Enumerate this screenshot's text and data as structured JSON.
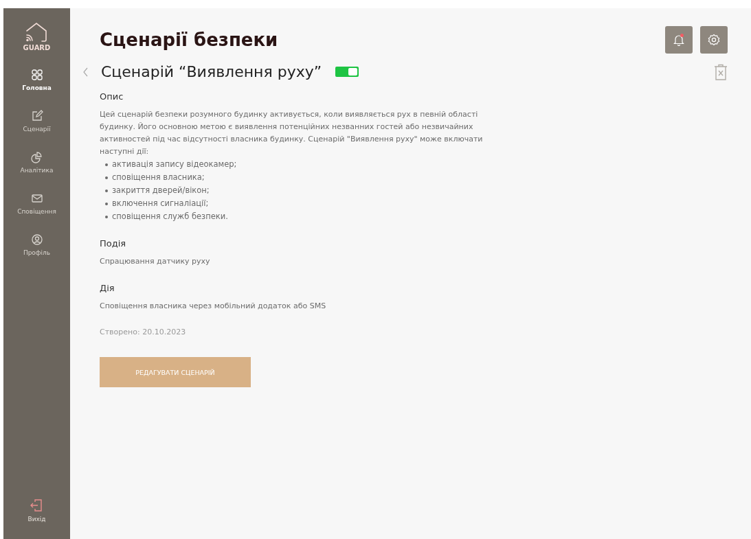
{
  "sidebar": {
    "logo": "GUARD",
    "items": [
      {
        "label": "Головна",
        "kind": "grid",
        "selected": true
      },
      {
        "label": "Сценарії",
        "kind": "edit",
        "selected": false
      },
      {
        "label": "Аналітика",
        "kind": "chart",
        "selected": false
      },
      {
        "label": "Сповіщення",
        "kind": "mail",
        "selected": false
      },
      {
        "label": "Профіль",
        "kind": "user",
        "selected": false
      }
    ],
    "logout": "Вихід"
  },
  "header": {
    "title": "Сценарії безпеки",
    "notifications_unread": true
  },
  "scenario": {
    "title": "Сценарій “Виявлення руху”",
    "enabled": true,
    "sections": [
      {
        "heading": "Опис",
        "text": "Цей сценарій безпеки розумного будинку активується, коли виявляється рух в певній області будинку. Його основною метою є виявлення потенційних незванних гостей або незвичайних активностей під час відсутності власника будинку. Сценарій \"Виявлення руху\" може включати наступні дії:",
        "bullets": [
          "активація запису відеокамер;",
          "сповіщення власника;",
          "закриття дверей/вікон;",
          "включення сигналіації;",
          "сповіщення служб безпеки."
        ]
      },
      {
        "heading": "Подія",
        "text": "Спрацювання датчику руху"
      },
      {
        "heading": "Дія",
        "text": "Сповіщення власника через мобільний додаток або SMS"
      }
    ],
    "created": "Створено: 20.10.2023",
    "edit_button": "РЕДАГУВАТИ СЦЕНАРІЙ"
  }
}
